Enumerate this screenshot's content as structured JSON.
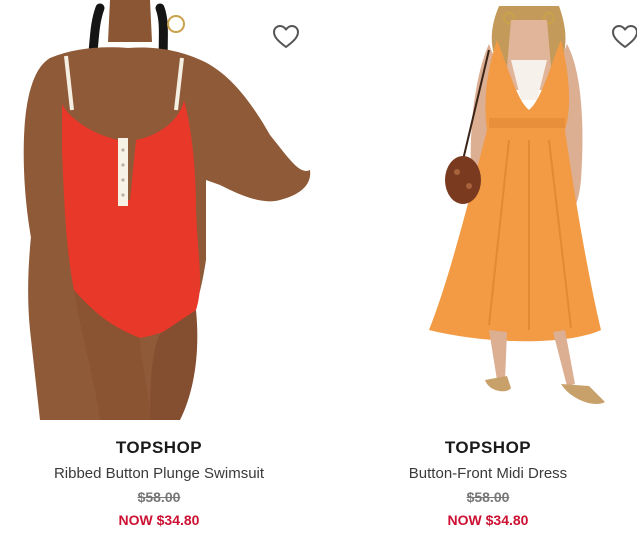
{
  "products": [
    {
      "brand": "TOPSHOP",
      "name": "Ribbed Button Plunge Swimsuit",
      "original_price": "$58.00",
      "sale_price": "NOW $34.80",
      "wishlist_icon": "heart-outline-icon"
    },
    {
      "brand": "TOPSHOP",
      "name": "Button-Front Midi Dress",
      "original_price": "$58.00",
      "sale_price": "NOW $34.80",
      "wishlist_icon": "heart-outline-icon"
    }
  ],
  "colors": {
    "sale_price": "#cc1133",
    "swimsuit": "#e8382a",
    "dress": "#f29a44"
  }
}
